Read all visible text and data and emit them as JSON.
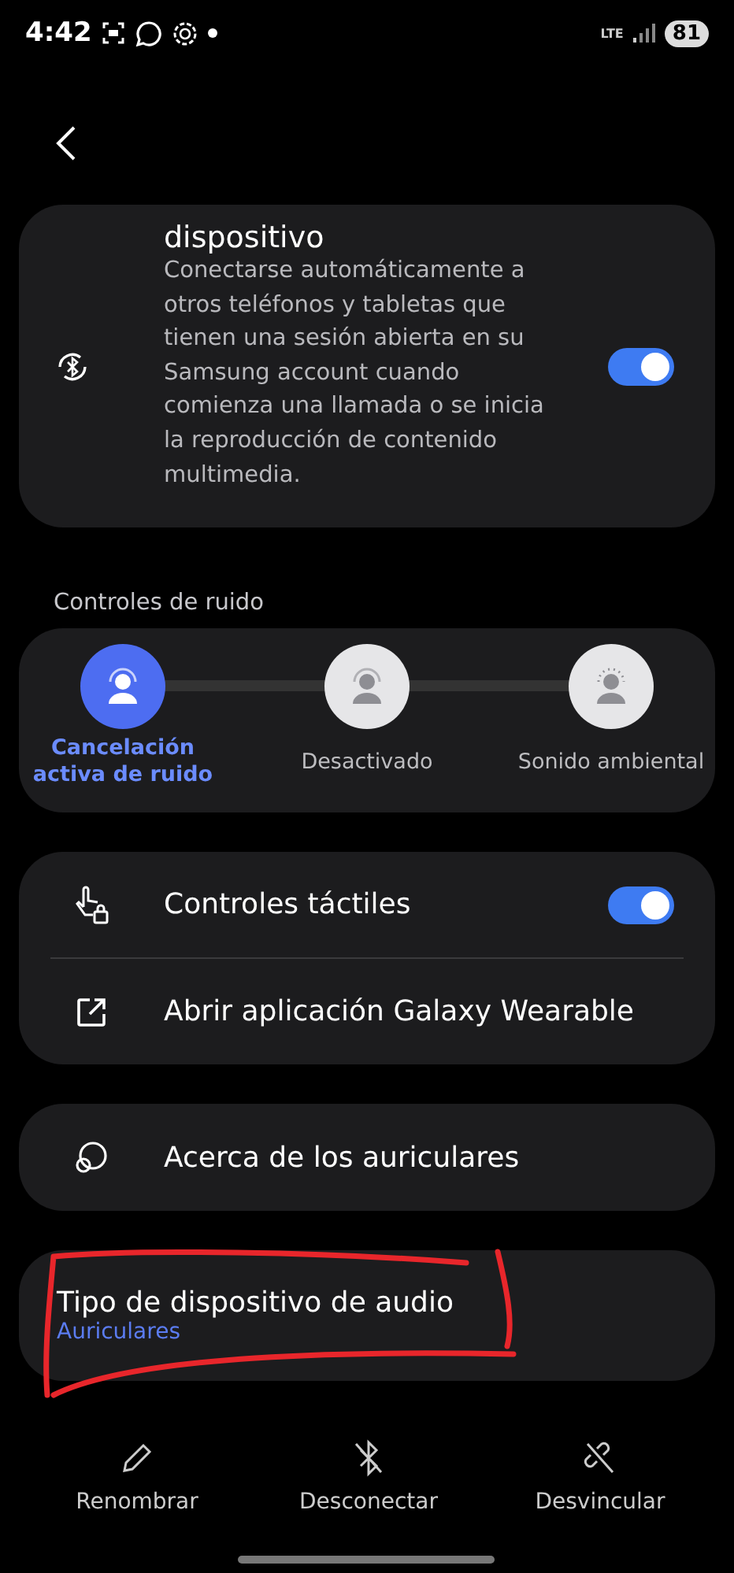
{
  "status_bar": {
    "time": "4:42",
    "network": "LTE",
    "battery": "81"
  },
  "auto_switch": {
    "title": "dispositivo",
    "description": "Conectarse automáticamente a otros teléfonos y tabletas que tienen una sesión abierta en su Samsung account cuando comienza una llamada o se inicia la reproducción de contenido multimedia.",
    "on": true
  },
  "noise_controls": {
    "label": "Controles de ruido",
    "options": [
      {
        "label": "Cancelación activa de ruido",
        "selected": true,
        "kind": "anc"
      },
      {
        "label": "Desactivado",
        "selected": false,
        "kind": "off"
      },
      {
        "label": "Sonido ambiental",
        "selected": false,
        "kind": "ambient"
      }
    ]
  },
  "settings_card": [
    {
      "kind": "toggle",
      "label": "Controles táctiles",
      "on": true
    },
    {
      "kind": "link",
      "label": "Abrir aplicación Galaxy Wearable"
    }
  ],
  "about": {
    "label": "Acerca de los auriculares"
  },
  "audio_type": {
    "title": "Tipo de dispositivo de audio",
    "value": "Auriculares"
  },
  "actions": [
    {
      "kind": "rename",
      "label": "Renombrar"
    },
    {
      "kind": "disconnect",
      "label": "Desconectar"
    },
    {
      "kind": "unpair",
      "label": "Desvincular"
    }
  ]
}
